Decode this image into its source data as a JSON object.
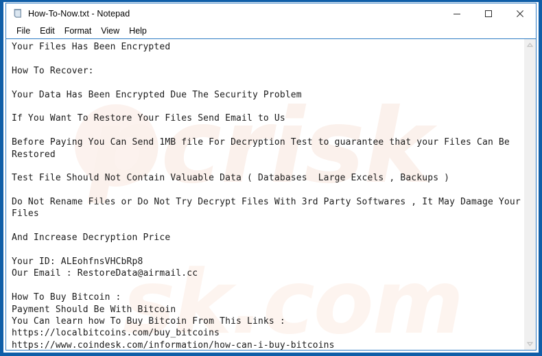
{
  "window": {
    "title": "How-To-Now.txt - Notepad",
    "icon": "notepad-icon",
    "frame_color": "#0f5ea8",
    "controls": {
      "minimize": "minimize-icon",
      "maximize": "maximize-icon",
      "close": "close-icon"
    }
  },
  "menubar": {
    "items": [
      {
        "label": "File"
      },
      {
        "label": "Edit"
      },
      {
        "label": "Format"
      },
      {
        "label": "View"
      },
      {
        "label": "Help"
      }
    ]
  },
  "editor": {
    "lines": [
      "Your Files Has Been Encrypted",
      "",
      "How To Recover:",
      "",
      "Your Data Has Been Encrypted Due The Security Problem",
      "",
      "If You Want To Restore Your Files Send Email to Us",
      "",
      "Before Paying You Can Send 1MB file For Decryption Test to guarantee that your Files Can Be",
      "Restored",
      "",
      "Test File Should Not Contain Valuable Data ( Databases  Large Excels , Backups )",
      "",
      "Do Not Rename Files or Do Not Try Decrypt Files With 3rd Party Softwares , It May Damage Your",
      "Files",
      "",
      "And Increase Decryption Price",
      "",
      "Your ID: ALEohfnsVHCbRp8",
      "Our Email : RestoreData@airmail.cc",
      "",
      "How To Buy Bitcoin :",
      "Payment Should Be With Bitcoin",
      "You Can learn how To Buy Bitcoin From This Links :",
      "https://localbitcoins.com/buy_bitcoins",
      "https://www.coindesk.com/information/how-can-i-buy-bitcoins"
    ],
    "victim_id": "ALEohfnsVHCbRp8",
    "contact_email": "RestoreData@airmail.cc",
    "links": [
      "https://localbitcoins.com/buy_bitcoins",
      "https://www.coindesk.com/information/how-can-i-buy-bitcoins"
    ],
    "text_color": "#1a1a1a",
    "background": "#ffffff"
  },
  "watermark": {
    "primary": "pcrisk",
    "secondary": "sk.com"
  },
  "scrollbar": {
    "up_arrow": "scroll-up-icon",
    "down_arrow": "scroll-down-icon",
    "track_color": "#f0f0f0"
  }
}
